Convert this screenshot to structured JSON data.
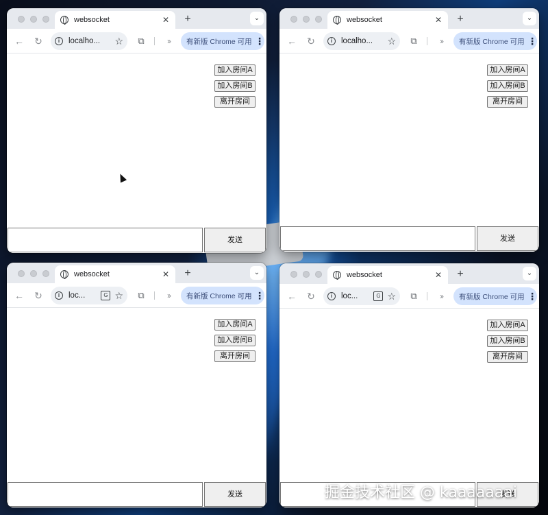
{
  "colors": {
    "update_pill_bg": "#d3e3fd",
    "tabstrip_bg": "#e6e9ee",
    "omnibox_bg": "#edf0f4"
  },
  "windows": [
    {
      "tab_title": "websocket",
      "url": "localho...",
      "translate_visible": false,
      "update_label": "有新版 Chrome 可用",
      "buttons": {
        "join_a": "加入房间A",
        "join_b": "加入房间B",
        "leave": "离开房间"
      },
      "send_label": "发送",
      "message_value": ""
    },
    {
      "tab_title": "websocket",
      "url": "localho...",
      "translate_visible": false,
      "update_label": "有新版 Chrome 可用",
      "buttons": {
        "join_a": "加入房间A",
        "join_b": "加入房间B",
        "leave": "离开房间"
      },
      "send_label": "发送",
      "message_value": ""
    },
    {
      "tab_title": "websocket",
      "url": "loc...",
      "translate_visible": true,
      "update_label": "有新版 Chrome 可用",
      "buttons": {
        "join_a": "加入房间A",
        "join_b": "加入房间B",
        "leave": "离开房间"
      },
      "send_label": "发送",
      "message_value": ""
    },
    {
      "tab_title": "websocket",
      "url": "loc...",
      "translate_visible": true,
      "update_label": "有新版 Chrome 可用",
      "buttons": {
        "join_a": "加入房间A",
        "join_b": "加入房间B",
        "leave": "离开房间"
      },
      "send_label": "发送",
      "message_value": ""
    }
  ],
  "icons": {
    "back": "back-arrow-icon",
    "reload": "reload-icon",
    "info": "info-icon",
    "translate": "translate-icon",
    "bookmark": "star-icon",
    "extensions": "puzzle-icon",
    "overflow": "chevron-double-right-icon",
    "menu": "kebab-menu-icon"
  },
  "watermark": "掘金技术社区 @ kaaaaaaai"
}
